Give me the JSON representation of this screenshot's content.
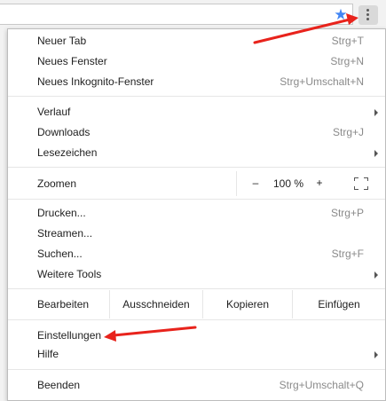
{
  "menu": {
    "group1": [
      {
        "label": "Neuer Tab",
        "shortcut": "Strg+T"
      },
      {
        "label": "Neues Fenster",
        "shortcut": "Strg+N"
      },
      {
        "label": "Neues Inkognito-Fenster",
        "shortcut": "Strg+Umschalt+N"
      }
    ],
    "group2": [
      {
        "label": "Verlauf",
        "shortcut": ""
      },
      {
        "label": "Downloads",
        "shortcut": "Strg+J"
      },
      {
        "label": "Lesezeichen",
        "shortcut": ""
      }
    ],
    "zoom": {
      "label": "Zoomen",
      "minus": "–",
      "value": "100 %",
      "plus": "+"
    },
    "group3": [
      {
        "label": "Drucken...",
        "shortcut": "Strg+P"
      },
      {
        "label": "Streamen...",
        "shortcut": ""
      },
      {
        "label": "Suchen...",
        "shortcut": "Strg+F"
      },
      {
        "label": "Weitere Tools",
        "shortcut": ""
      }
    ],
    "edit": {
      "label": "Bearbeiten",
      "cut": "Ausschneiden",
      "copy": "Kopieren",
      "paste": "Einfügen"
    },
    "group4": [
      {
        "label": "Einstellungen",
        "shortcut": ""
      },
      {
        "label": "Hilfe",
        "shortcut": ""
      }
    ],
    "exit": {
      "label": "Beenden",
      "shortcut": "Strg+Umschalt+Q"
    }
  },
  "toolbar": {
    "star_icon": "star-icon",
    "menu_icon": "three-dots-vertical-icon"
  },
  "colors": {
    "annotation_arrow": "#e8231c",
    "star": "#4285f4"
  }
}
